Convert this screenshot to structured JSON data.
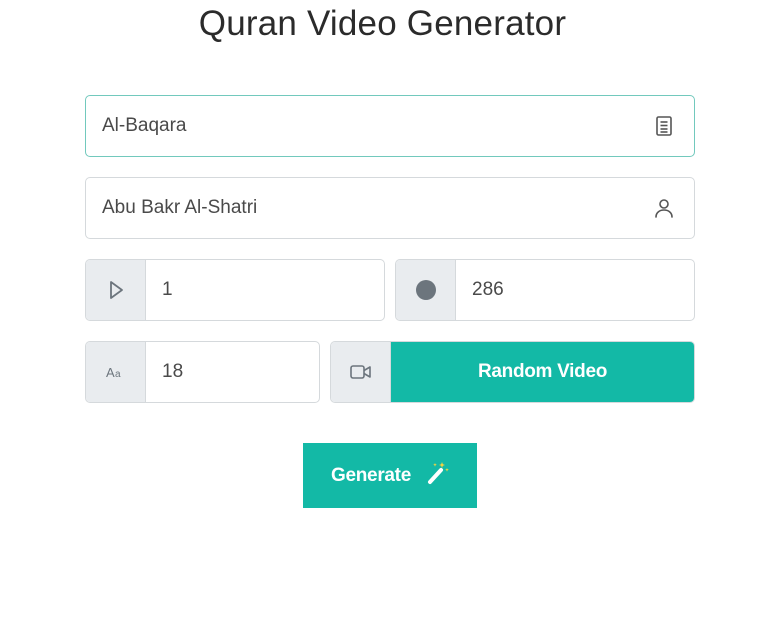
{
  "page": {
    "title": "Quran Video Generator"
  },
  "surah": {
    "value": "Al-Baqara",
    "icon": "book-icon"
  },
  "reciter": {
    "value": "Abu Bakr Al-Shatri",
    "icon": "user-icon"
  },
  "start_ayah": {
    "value": "1",
    "icon": "play-icon"
  },
  "end_ayah": {
    "value": "286",
    "icon": "stop-circle-icon"
  },
  "font_size": {
    "value": "18",
    "icon": "font-size-icon"
  },
  "video": {
    "icon": "video-camera-icon",
    "button_label": "Random Video"
  },
  "generate": {
    "label": "Generate",
    "icon": "magic-wand-icon"
  },
  "colors": {
    "accent": "#13b9a6",
    "addon_bg": "#e9ecef",
    "focus_border": "#72c9bd"
  }
}
